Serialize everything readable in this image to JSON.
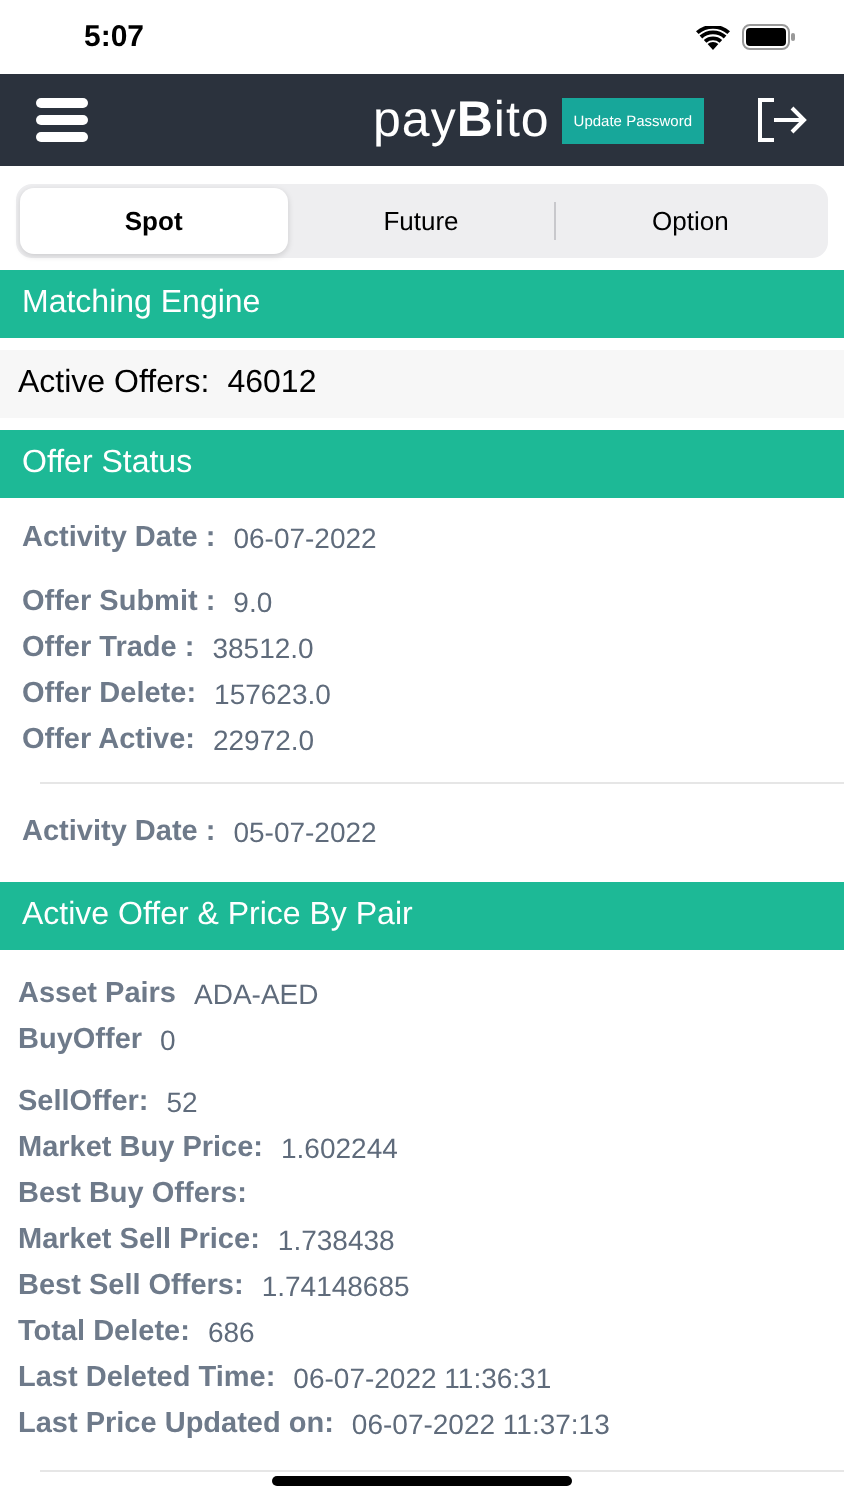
{
  "status_bar": {
    "time": "5:07"
  },
  "navbar": {
    "logo": "pay**B**ito",
    "update_button": "Update Password"
  },
  "tabs": [
    {
      "label": "Spot",
      "selected": true
    },
    {
      "label": "Future",
      "selected": false
    },
    {
      "label": "Option",
      "selected": false
    }
  ],
  "matching_engine": {
    "title": "Matching Engine",
    "label": "Active Offers:",
    "value": "46012"
  },
  "offer_status": {
    "title": "Offer Status",
    "days": [
      {
        "date_label": "Activity Date :",
        "date": "06-07-2022",
        "rows": [
          {
            "label": "Offer Submit :",
            "value": "9.0"
          },
          {
            "label": "Offer Trade :",
            "value": "38512.0"
          },
          {
            "label": "Offer Delete:",
            "value": "157623.0"
          },
          {
            "label": "Offer Active:",
            "value": "22972.0"
          }
        ]
      },
      {
        "date_label": "Activity Date :",
        "date": "05-07-2022"
      }
    ]
  },
  "pair_section": {
    "title": "Active Offer & Price By Pair",
    "groups": [
      [
        {
          "label": "Asset Pairs",
          "value": "ADA-AED"
        },
        {
          "label": "BuyOffer",
          "value": "0"
        }
      ],
      [
        {
          "label": "SellOffer:",
          "value": "52"
        },
        {
          "label": "Market Buy Price:",
          "value": "1.602244"
        },
        {
          "label": "Best Buy Offers:"
        },
        {
          "label": "Market Sell Price:",
          "value": "1.738438"
        },
        {
          "label": "Best Sell Offers:",
          "value": "1.74148685"
        },
        {
          "label": "Total Delete:",
          "value": "686"
        },
        {
          "label": "Last Deleted Time:",
          "value": "06-07-2022 11:36:31"
        },
        {
          "label": "Last Price Updated on:",
          "value": "06-07-2022 11:37:13"
        }
      ]
    ]
  }
}
